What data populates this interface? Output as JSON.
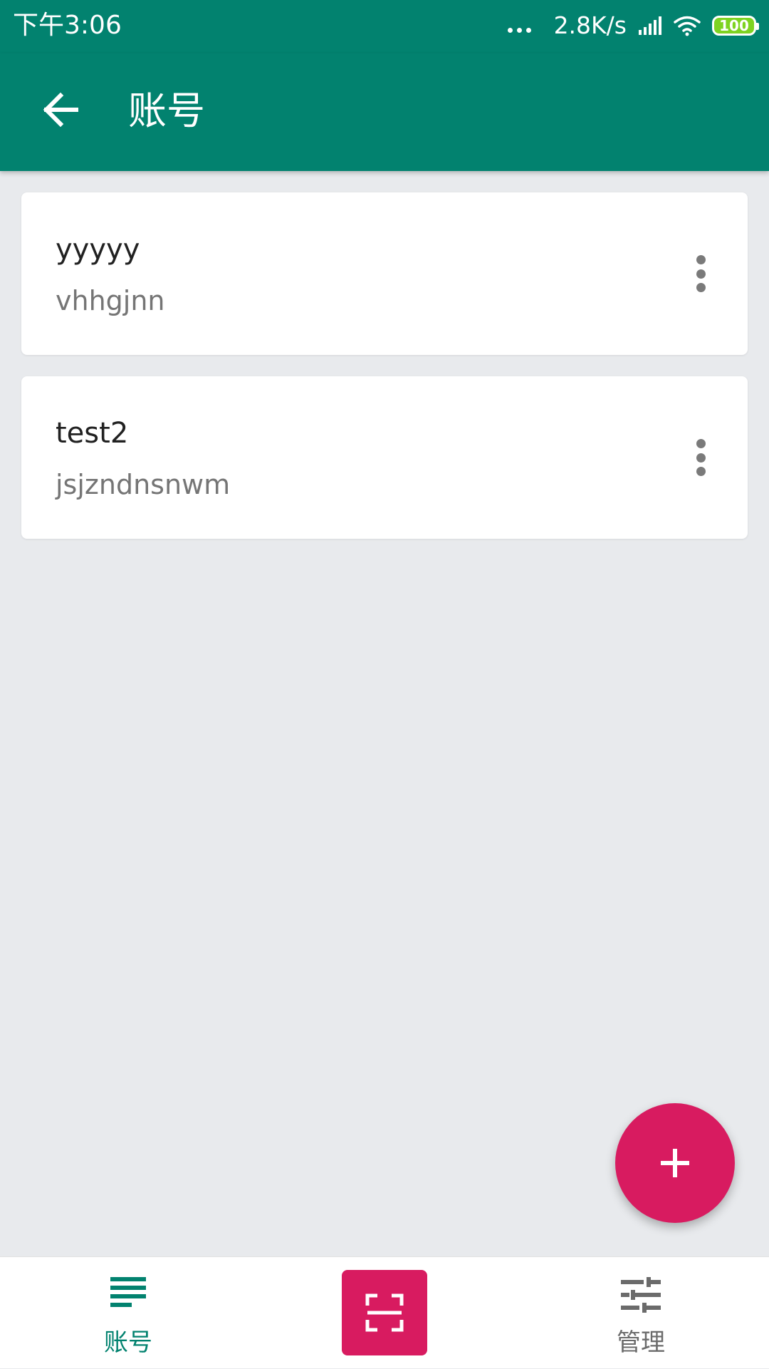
{
  "status_bar": {
    "time": "下午3:06",
    "network_speed": "2.8K/s",
    "battery_level": "100",
    "icons": [
      "more-dots-icon",
      "signal-icon",
      "wifi-icon",
      "battery-icon"
    ]
  },
  "app_bar": {
    "title": "账号",
    "back_icon": "arrow-back-icon"
  },
  "accounts": [
    {
      "name": "yyyyy",
      "detail": "vhhgjnn",
      "menu_icon": "more-vert-icon"
    },
    {
      "name": "test2",
      "detail": "jsjzndnsnwm",
      "menu_icon": "more-vert-icon"
    }
  ],
  "fab": {
    "icon": "plus-icon"
  },
  "bottom_nav": {
    "accounts_label": "账号",
    "accounts_icon": "list-icon",
    "scan_icon": "scan-icon",
    "manage_label": "管理",
    "manage_icon": "tune-icon"
  },
  "colors": {
    "primary": "#02826F",
    "accent": "#D81B60",
    "background": "#E8EAED",
    "card": "#FFFFFF",
    "battery": "#7ED321"
  }
}
